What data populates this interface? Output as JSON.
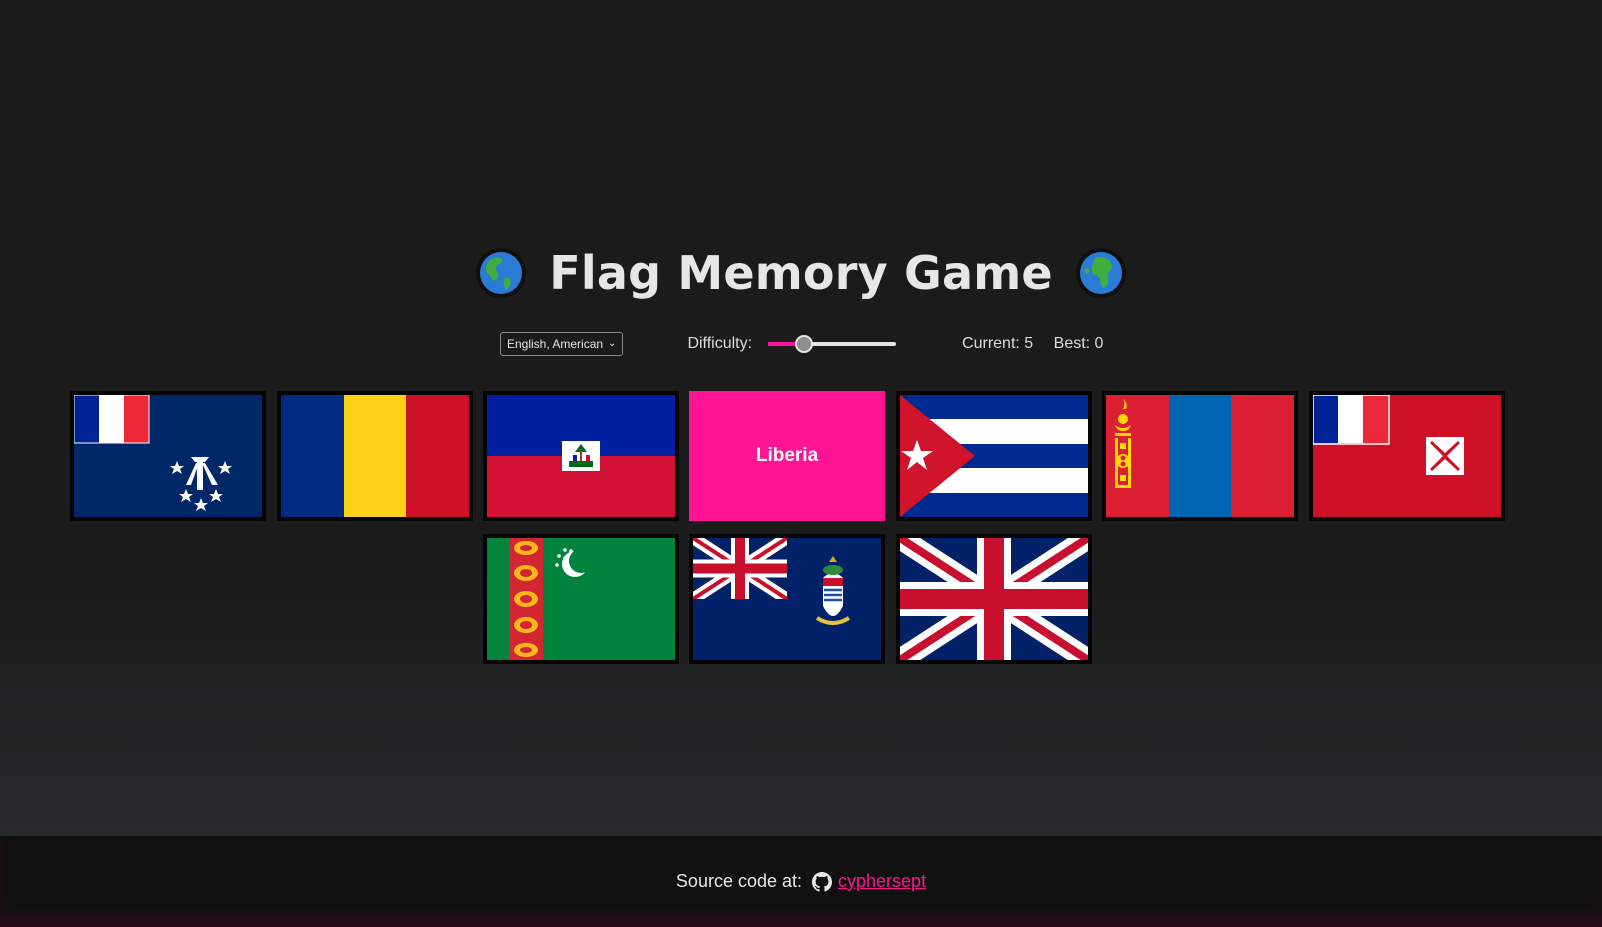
{
  "header": {
    "title": "Flag Memory Game",
    "left_icon": "globe-americas-icon",
    "right_icon": "globe-africa-icon"
  },
  "controls": {
    "language": "English, American",
    "difficulty_label": "Difficulty:",
    "difficulty_level": 0.28,
    "current": "Current: 5",
    "best": "Best: 0"
  },
  "cards": [
    {
      "flag": "french-southern-territories",
      "revealed": false
    },
    {
      "flag": "romania",
      "revealed": false
    },
    {
      "flag": "haiti",
      "revealed": false
    },
    {
      "flag": "liberia",
      "revealed": true,
      "label": "Liberia"
    },
    {
      "flag": "cuba",
      "revealed": false
    },
    {
      "flag": "mongolia",
      "revealed": false
    },
    {
      "flag": "wallis-and-futuna",
      "revealed": false
    },
    {
      "flag": "turkmenistan",
      "revealed": false
    },
    {
      "flag": "cayman-islands",
      "revealed": false
    },
    {
      "flag": "united-kingdom",
      "revealed": false
    }
  ],
  "footer": {
    "text": "Source code at:",
    "link": "cyphersept",
    "icon": "github-icon"
  },
  "colors": {
    "accent": "#ff1493",
    "background": "#1b1b1b",
    "footer": "#111111"
  }
}
